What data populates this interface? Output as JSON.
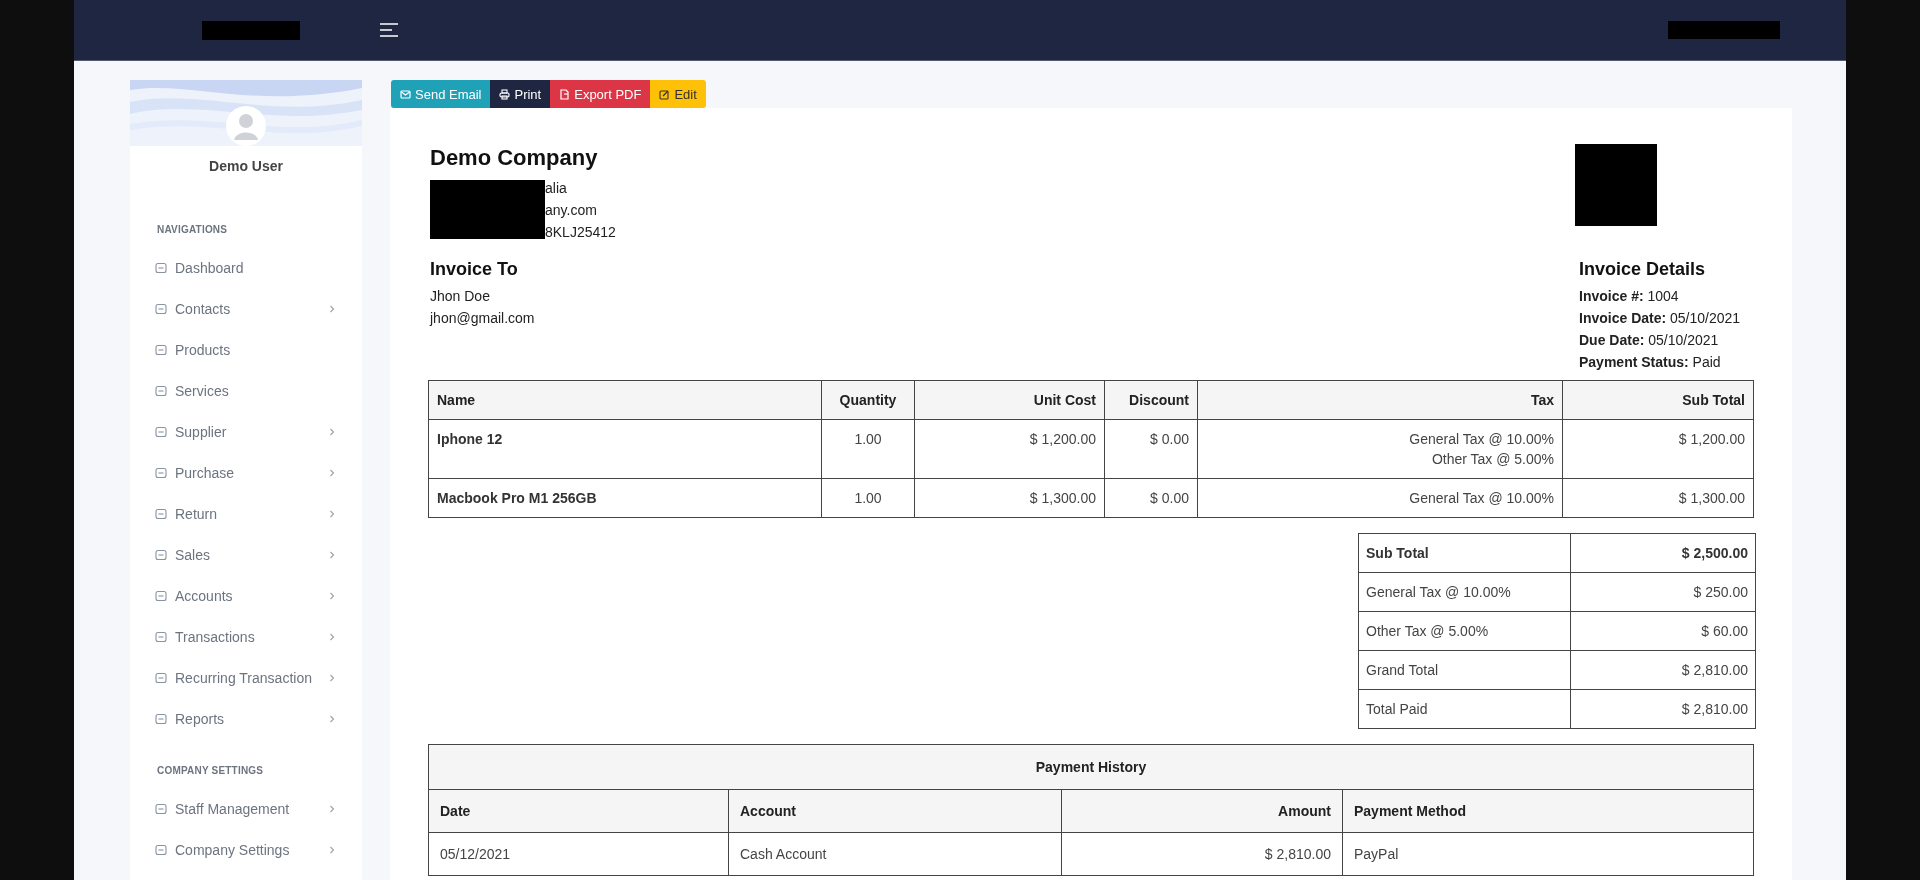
{
  "sidebar": {
    "user_name": "Demo User",
    "sections": [
      {
        "heading": "NAVIGATIONS",
        "items": [
          {
            "label": "Dashboard",
            "expandable": false
          },
          {
            "label": "Contacts",
            "expandable": true
          },
          {
            "label": "Products",
            "expandable": false
          },
          {
            "label": "Services",
            "expandable": false
          },
          {
            "label": "Supplier",
            "expandable": true
          },
          {
            "label": "Purchase",
            "expandable": true
          },
          {
            "label": "Return",
            "expandable": true
          },
          {
            "label": "Sales",
            "expandable": true
          },
          {
            "label": "Accounts",
            "expandable": true
          },
          {
            "label": "Transactions",
            "expandable": true
          },
          {
            "label": "Recurring Transaction",
            "expandable": true
          },
          {
            "label": "Reports",
            "expandable": true
          }
        ]
      },
      {
        "heading": "COMPANY SETTINGS",
        "items": [
          {
            "label": "Staff Management",
            "expandable": true
          },
          {
            "label": "Company Settings",
            "expandable": true
          }
        ]
      }
    ]
  },
  "actions": [
    {
      "label": "Send Email",
      "kind": "email"
    },
    {
      "label": "Print",
      "kind": "print"
    },
    {
      "label": "Export PDF",
      "kind": "pdf"
    },
    {
      "label": "Edit",
      "kind": "edit"
    }
  ],
  "company": {
    "name": "Demo Company",
    "address_lines": [
      "alia",
      "any.com",
      "8KLJ25412"
    ]
  },
  "bill_to": {
    "heading": "Invoice To",
    "lines": [
      "Jhon Doe",
      "jhon@gmail.com"
    ]
  },
  "details": {
    "heading": "Invoice Details",
    "fields": [
      {
        "label": "Invoice #:",
        "value": "1004"
      },
      {
        "label": "Invoice Date:",
        "value": "05/10/2021"
      },
      {
        "label": "Due Date:",
        "value": "05/10/2021"
      },
      {
        "label": "Payment Status:",
        "value": "Paid"
      }
    ]
  },
  "items_table": {
    "columns": [
      "Name",
      "Quantity",
      "Unit Cost",
      "Discount",
      "Tax",
      "Sub Total"
    ],
    "rows": [
      {
        "name": "Iphone 12",
        "quantity": "1.00",
        "unit_cost": "$ 1,200.00",
        "discount": "$ 0.00",
        "taxes": [
          "General Tax @ 10.00%",
          "Other Tax @ 5.00%"
        ],
        "sub_total": "$ 1,200.00"
      },
      {
        "name": "Macbook Pro M1 256GB",
        "quantity": "1.00",
        "unit_cost": "$ 1,300.00",
        "discount": "$ 0.00",
        "taxes": [
          "General Tax @ 10.00%"
        ],
        "sub_total": "$ 1,300.00"
      }
    ]
  },
  "totals": [
    {
      "label": "Sub Total",
      "value": "$ 2,500.00",
      "emphasis": true
    },
    {
      "label": "General Tax @ 10.00%",
      "value": "$ 250.00",
      "emphasis": false
    },
    {
      "label": "Other Tax @ 5.00%",
      "value": "$ 60.00",
      "emphasis": false
    },
    {
      "label": "Grand Total",
      "value": "$ 2,810.00",
      "emphasis": false
    },
    {
      "label": "Total Paid",
      "value": "$ 2,810.00",
      "emphasis": false
    }
  ],
  "payment_history": {
    "title": "Payment History",
    "columns": [
      "Date",
      "Account",
      "Amount",
      "Payment Method"
    ],
    "rows": [
      {
        "date": "05/12/2021",
        "account": "Cash Account",
        "amount": "$ 2,810.00",
        "method": "PayPal"
      }
    ]
  }
}
